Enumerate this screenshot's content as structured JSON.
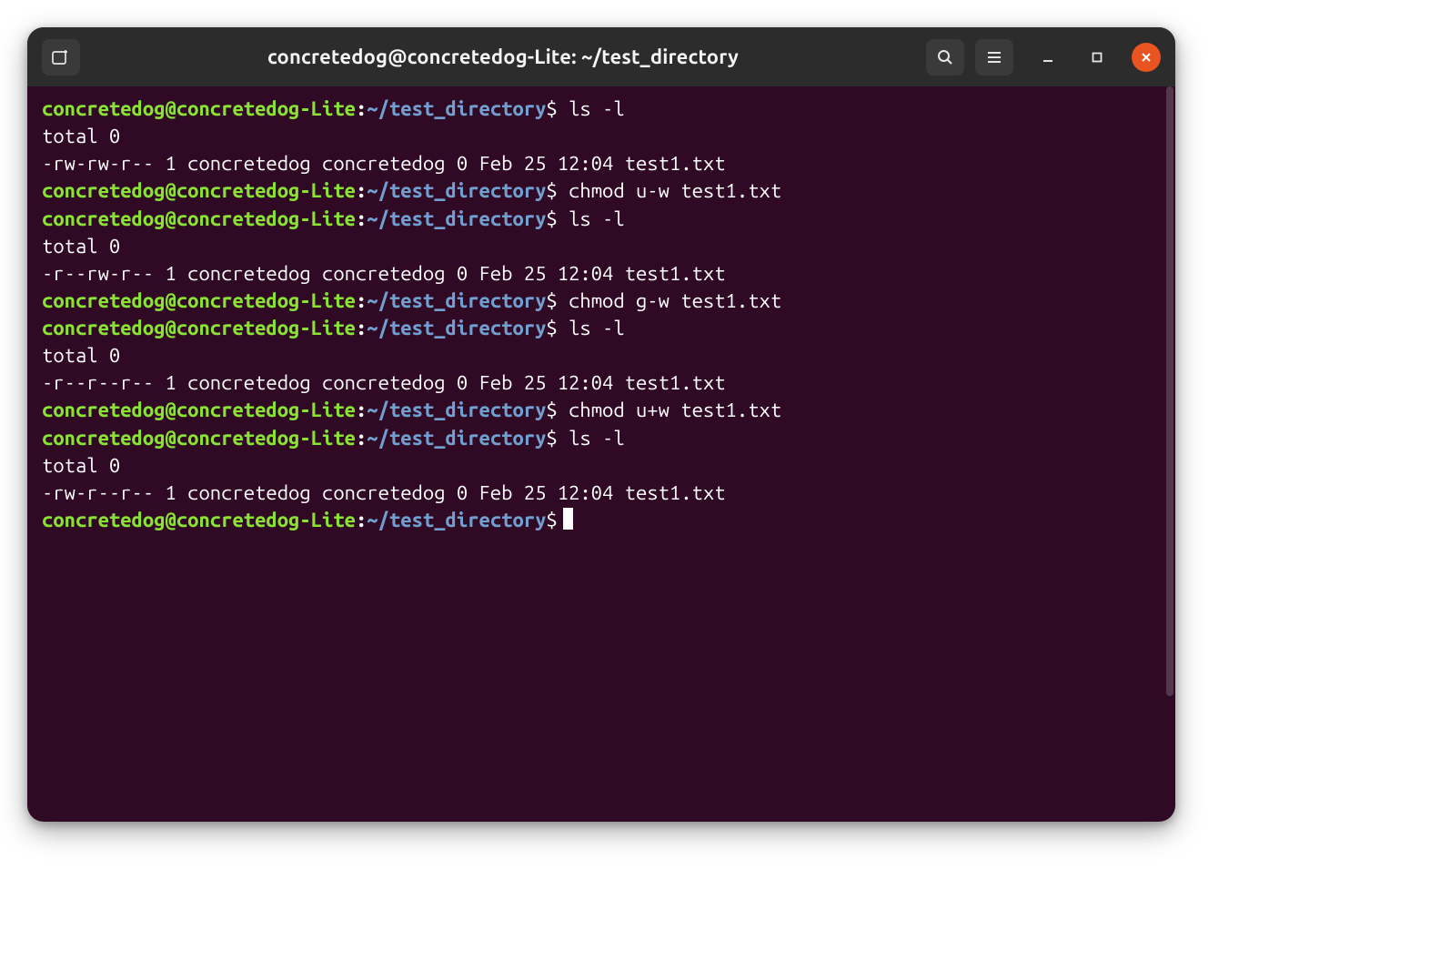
{
  "window": {
    "title": "concretedog@concretedog-Lite: ~/test_directory"
  },
  "prompt": {
    "user_host": "concretedog@concretedog-Lite",
    "path": "~/test_directory",
    "symbol": "$"
  },
  "lines": [
    {
      "type": "prompt",
      "cmd": "ls -l"
    },
    {
      "type": "output",
      "text": "total 0"
    },
    {
      "type": "output",
      "text": "-rw-rw-r-- 1 concretedog concretedog 0 Feb 25 12:04 test1.txt"
    },
    {
      "type": "prompt",
      "cmd": "chmod u-w test1.txt"
    },
    {
      "type": "prompt",
      "cmd": "ls -l"
    },
    {
      "type": "output",
      "text": "total 0"
    },
    {
      "type": "output",
      "text": "-r--rw-r-- 1 concretedog concretedog 0 Feb 25 12:04 test1.txt"
    },
    {
      "type": "prompt",
      "cmd": "chmod g-w test1.txt"
    },
    {
      "type": "prompt",
      "cmd": "ls -l"
    },
    {
      "type": "output",
      "text": "total 0"
    },
    {
      "type": "output",
      "text": "-r--r--r-- 1 concretedog concretedog 0 Feb 25 12:04 test1.txt"
    },
    {
      "type": "prompt",
      "cmd": "chmod u+w test1.txt"
    },
    {
      "type": "prompt",
      "cmd": "ls -l"
    },
    {
      "type": "output",
      "text": "total 0"
    },
    {
      "type": "output",
      "text": "-rw-r--r-- 1 concretedog concretedog 0 Feb 25 12:04 test1.txt"
    },
    {
      "type": "prompt_cursor",
      "cmd": ""
    }
  ],
  "icons": {
    "new_tab": "new-tab-icon",
    "search": "search-icon",
    "menu": "hamburger-icon",
    "minimize": "minimize-icon",
    "maximize": "maximize-icon",
    "close": "close-icon"
  }
}
